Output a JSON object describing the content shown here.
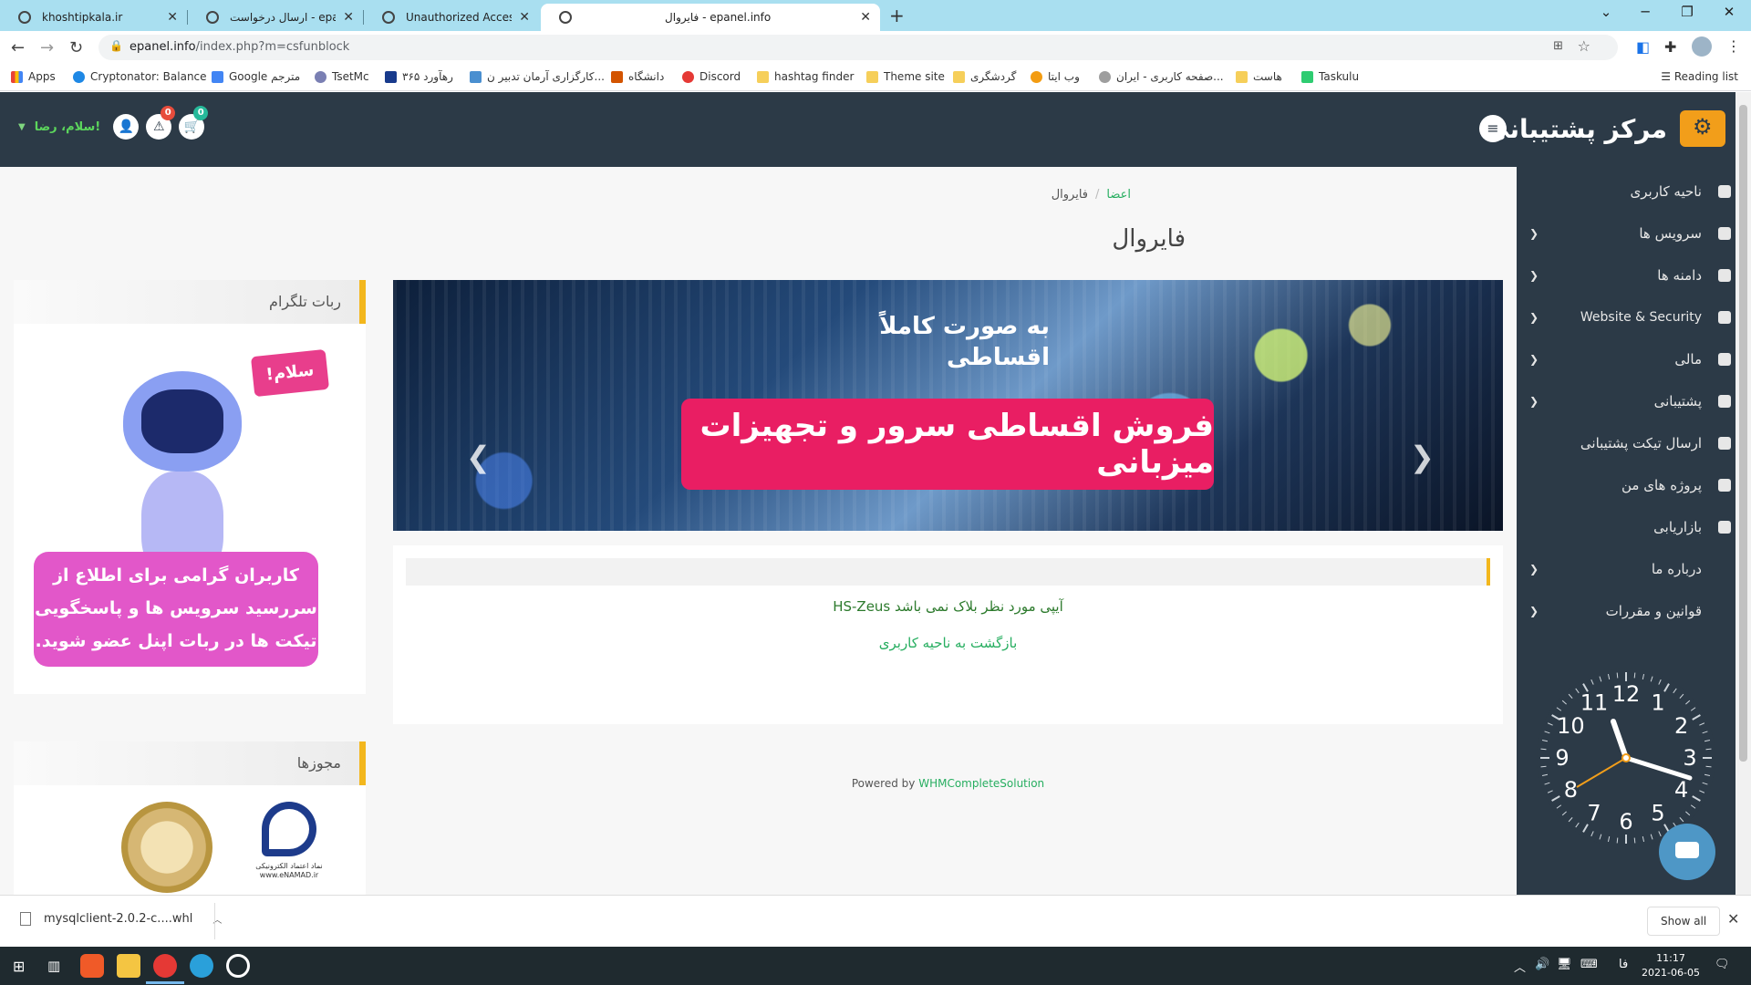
{
  "browser": {
    "tabs": [
      {
        "title": "khoshtipkala.ir",
        "active": false
      },
      {
        "title": "ارسال درخواست - epanel.info",
        "active": false
      },
      {
        "title": "Unauthorized Access",
        "active": false
      },
      {
        "title": "فایروال - epanel.info",
        "active": true
      }
    ],
    "url_host": "epanel.info",
    "url_path": "/index.php?m=csfunblock",
    "bookmarks": [
      "Apps",
      "Cryptonator: Balance",
      "Google مترجم",
      "TsetMc",
      "رهآورد ۳۶۵",
      "کارگزاری آرمان تدبیر ن...",
      "دانشگاه",
      "Discord",
      "hashtag finder",
      "Theme site",
      "گردشگری",
      "وب ایتا",
      "صفحه کاربری - ایران...",
      "هاست",
      "Taskulu"
    ],
    "reading_list": "Reading list"
  },
  "site": {
    "brand": "مرکز پشتیبانی",
    "greeting": "سلام، رضا!",
    "alerts_count": "0",
    "cart_count": "0",
    "breadcrumb": {
      "home": "اعضا",
      "current": "فایروال"
    },
    "page_title": "فایروال",
    "sidebar": [
      {
        "label": "ناحیه کاربری",
        "chevron": false
      },
      {
        "label": "سرویس ها",
        "chevron": true
      },
      {
        "label": "دامنه ها",
        "chevron": true
      },
      {
        "label": "Website & Security",
        "chevron": true
      },
      {
        "label": "مالی",
        "chevron": true
      },
      {
        "label": "پشتیبانی",
        "chevron": true
      },
      {
        "label": "ارسال تیکت پشتیبانی",
        "chevron": false
      },
      {
        "label": "پروژه های من",
        "chevron": false
      },
      {
        "label": "بازاریابی",
        "chevron": false
      },
      {
        "label": "درباره ما",
        "chevron": true
      },
      {
        "label": "قوانین و مقررات",
        "chevron": true
      }
    ],
    "banner": {
      "subtitle": "به صورت کاملاً اقساطی",
      "headline": "فروش اقساطی سرور و تجهیزات میزبانی"
    },
    "notice": {
      "message": "آیپی مورد نظر بلاک نمی باشد HS-Zeus",
      "back_link": "بازگشت به ناحیه کاربری"
    },
    "powered": {
      "prefix": "Powered by",
      "link": "WHMCompleteSolution"
    },
    "telegram_panel": {
      "title": "ربات تلگرام",
      "hello": "سلام!",
      "text": "کاربران گرامی برای اطلاع از سررسید سرویس ها و پاسخگویی تیکت ها در ربات اپنل عضو شوید."
    },
    "licenses_panel": {
      "title": "مجوزها",
      "enamad_caption": "نماد اعتماد الکترونیکی www.eNAMAD.ir"
    },
    "clock": {
      "hours": [
        "12",
        "1",
        "2",
        "3",
        "4",
        "5",
        "6",
        "7",
        "8",
        "9",
        "10",
        "11"
      ],
      "time": "11:17"
    }
  },
  "download_bar": {
    "file": "mysqlclient-2.0.2-c....whl",
    "show_all": "Show all"
  },
  "taskbar": {
    "lang": "فا",
    "time": "11:17",
    "date": "2021-06-05"
  },
  "colors": {
    "nav": "#2c3a47",
    "accent": "#f3b71d",
    "green": "#27ae60",
    "pink": "#e91e63"
  }
}
